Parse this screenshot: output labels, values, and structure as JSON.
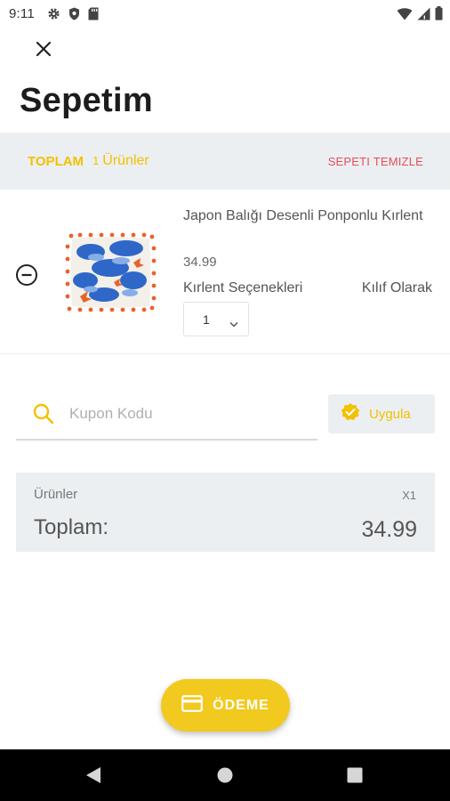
{
  "status_bar": {
    "time": "9:11",
    "left_icons": [
      "gear-icon",
      "shield-icon",
      "sd-card-icon"
    ],
    "right_icons": [
      "wifi-icon",
      "cell-signal-icon",
      "battery-icon"
    ]
  },
  "header": {
    "close_icon": "close-icon",
    "title": "Sepetim"
  },
  "summary": {
    "total_label": "TOPLAM",
    "item_count": "1",
    "item_label": "Ürünler",
    "clear_label": "SEPETI TEMIZLE"
  },
  "product": {
    "name": "Japon Balığı Desenli Ponponlu Kırlent",
    "price": "34.99",
    "option_label": "Kırlent Seçenekleri",
    "option_value": "Kılıf Olarak",
    "quantity": "1",
    "remove_icon": "minus-circle-icon"
  },
  "coupon": {
    "placeholder": "Kupon Kodu",
    "value": "",
    "apply_label": "Uygula",
    "apply_icon": "check-badge-icon",
    "search_icon": "search-icon"
  },
  "totals": {
    "items_label": "Ürünler",
    "items_count": "X1",
    "total_label": "Toplam:",
    "total_value": "34.99"
  },
  "pay": {
    "label": "ÖDEME",
    "icon": "credit-card-icon"
  },
  "nav": {
    "back": "back-icon",
    "home": "home-icon",
    "recents": "recents-icon"
  },
  "colors": {
    "accent_yellow": "#f2c100",
    "button_yellow": "#f2c91f",
    "danger": "#e84c5a",
    "panel": "#eceff1"
  }
}
